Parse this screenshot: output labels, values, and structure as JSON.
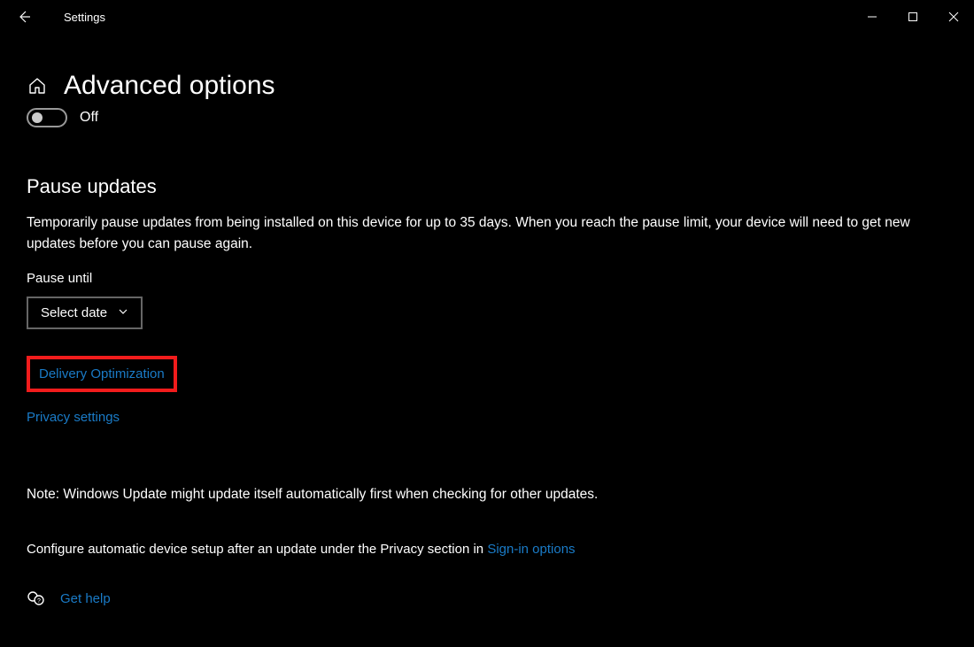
{
  "titlebar": {
    "app_title": "Settings"
  },
  "page": {
    "title": "Advanced options",
    "toggle_label": "Off"
  },
  "pause": {
    "heading": "Pause updates",
    "description": "Temporarily pause updates from being installed on this device for up to 35 days. When you reach the pause limit, your device will need to get new updates before you can pause again.",
    "field_label": "Pause until",
    "select_value": "Select date"
  },
  "links": {
    "delivery": "Delivery Optimization",
    "privacy": "Privacy settings"
  },
  "notes": {
    "line1": "Note: Windows Update might update itself automatically first when checking for other updates.",
    "line2_prefix": "Configure automatic device setup after an update under the Privacy section in ",
    "line2_link": "Sign-in options"
  },
  "help": {
    "label": "Get help"
  }
}
